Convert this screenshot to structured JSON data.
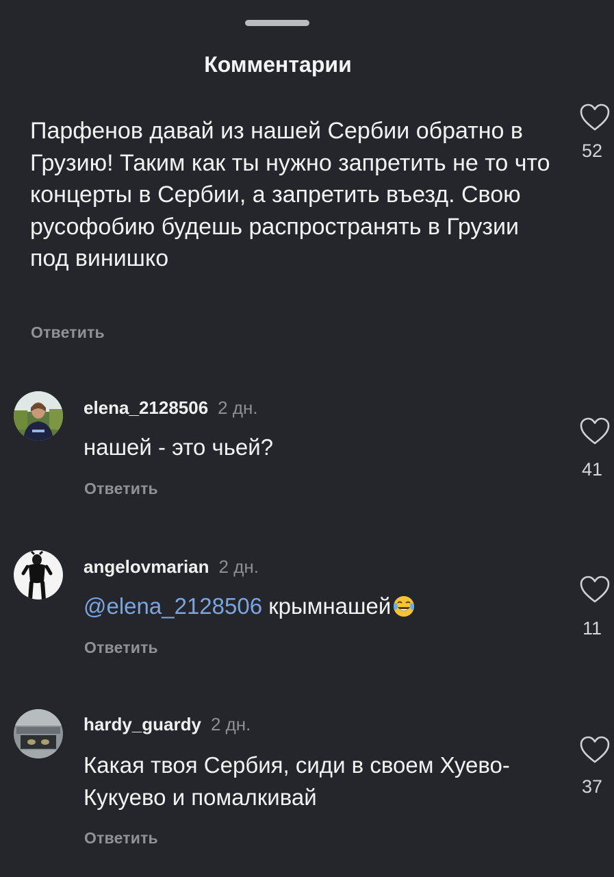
{
  "sheet": {
    "title": "Комментарии"
  },
  "main_comment": {
    "text": "Парфенов давай из нашей Сербии обратно в Грузию!  Таким как ты нужно запретить не то что концерты в Сербии, а запретить въезд. Свою русофобию будешь распространять в Грузии под винишко",
    "reply_label": "Ответить",
    "likes": "52"
  },
  "replies": [
    {
      "username": "elena_2128506",
      "age": "2 дн.",
      "text": "нашей - это чьей?",
      "reply_label": "Ответить",
      "likes": "41"
    },
    {
      "username": "angelovmarian",
      "age": "2 дн.",
      "mention": "@elena_2128506",
      "text": " крымнашей",
      "emoji": "face-with-tears-of-joy",
      "reply_label": "Ответить",
      "likes": "11"
    },
    {
      "username": "hardy_guardy",
      "age": "2 дн.",
      "text": "Какая твоя Сербия, сиди в своем Хуево-Кукуево и помалкивай",
      "reply_label": "Ответить",
      "likes": "37"
    }
  ],
  "colors": {
    "background": "#25262b",
    "text": "#f2f2f2",
    "secondary": "#909298",
    "mention": "#7aa6e0"
  }
}
